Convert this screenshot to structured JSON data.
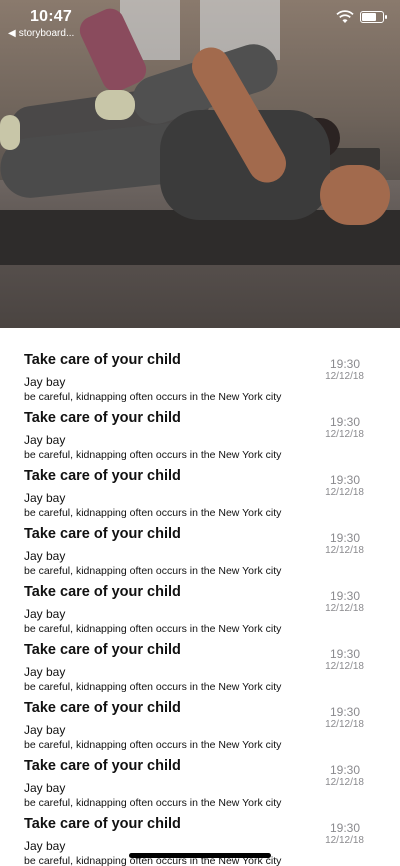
{
  "status_bar": {
    "time": "10:47",
    "back_app_label": "storyboard..."
  },
  "hero": {
    "image_icon": "workout-photo"
  },
  "messages": [
    {
      "title": "Take care of your child",
      "sender": "Jay bay",
      "preview": "be careful, kidnapping often occurs in the New York city",
      "time": "19:30",
      "date": "12/12/18"
    },
    {
      "title": "Take care of your child",
      "sender": "Jay bay",
      "preview": "be careful, kidnapping often occurs in the New York city",
      "time": "19:30",
      "date": "12/12/18"
    },
    {
      "title": "Take care of your child",
      "sender": "Jay bay",
      "preview": "be careful, kidnapping often occurs in the New York city",
      "time": "19:30",
      "date": "12/12/18"
    },
    {
      "title": "Take care of your child",
      "sender": "Jay bay",
      "preview": "be careful, kidnapping often occurs in the New York city",
      "time": "19:30",
      "date": "12/12/18"
    },
    {
      "title": "Take care of your child",
      "sender": "Jay bay",
      "preview": "be careful, kidnapping often occurs in the New York city",
      "time": "19:30",
      "date": "12/12/18"
    },
    {
      "title": "Take care of your child",
      "sender": "Jay bay",
      "preview": "be careful, kidnapping often occurs in the New York city",
      "time": "19:30",
      "date": "12/12/18"
    },
    {
      "title": "Take care of your child",
      "sender": "Jay bay",
      "preview": "be careful, kidnapping often occurs in the New York city",
      "time": "19:30",
      "date": "12/12/18"
    },
    {
      "title": "Take care of your child",
      "sender": "Jay bay",
      "preview": "be careful, kidnapping often occurs in the New York city",
      "time": "19:30",
      "date": "12/12/18"
    },
    {
      "title": "Take care of your child",
      "sender": "Jay bay",
      "preview": "be careful, kidnapping often occurs in the New York city",
      "time": "19:30",
      "date": "12/12/18"
    }
  ]
}
